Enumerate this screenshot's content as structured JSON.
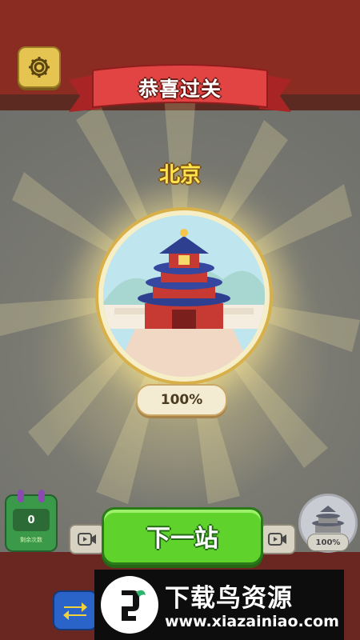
{
  "header": {
    "banner_title": "恭喜过关",
    "settings_icon": "gear-icon"
  },
  "level": {
    "city_name": "北京",
    "landmark_icon": "temple-of-heaven-icon",
    "progress_text": "100%"
  },
  "bottom": {
    "calendar": {
      "count": "0",
      "label": "剩余次数"
    },
    "next_button_label": "下一站",
    "mini_progress_text": "100%",
    "video_icon": "video-icon",
    "swap_icon": "swap-arrows-icon"
  },
  "watermark": {
    "title": "下载鸟资源",
    "url": "www.xiazainiao.com"
  },
  "colors": {
    "banner": "#d93a3a",
    "city_name": "#ffe44a",
    "next_button": "#5fd22c",
    "medal_ring": "#d8b04a"
  }
}
